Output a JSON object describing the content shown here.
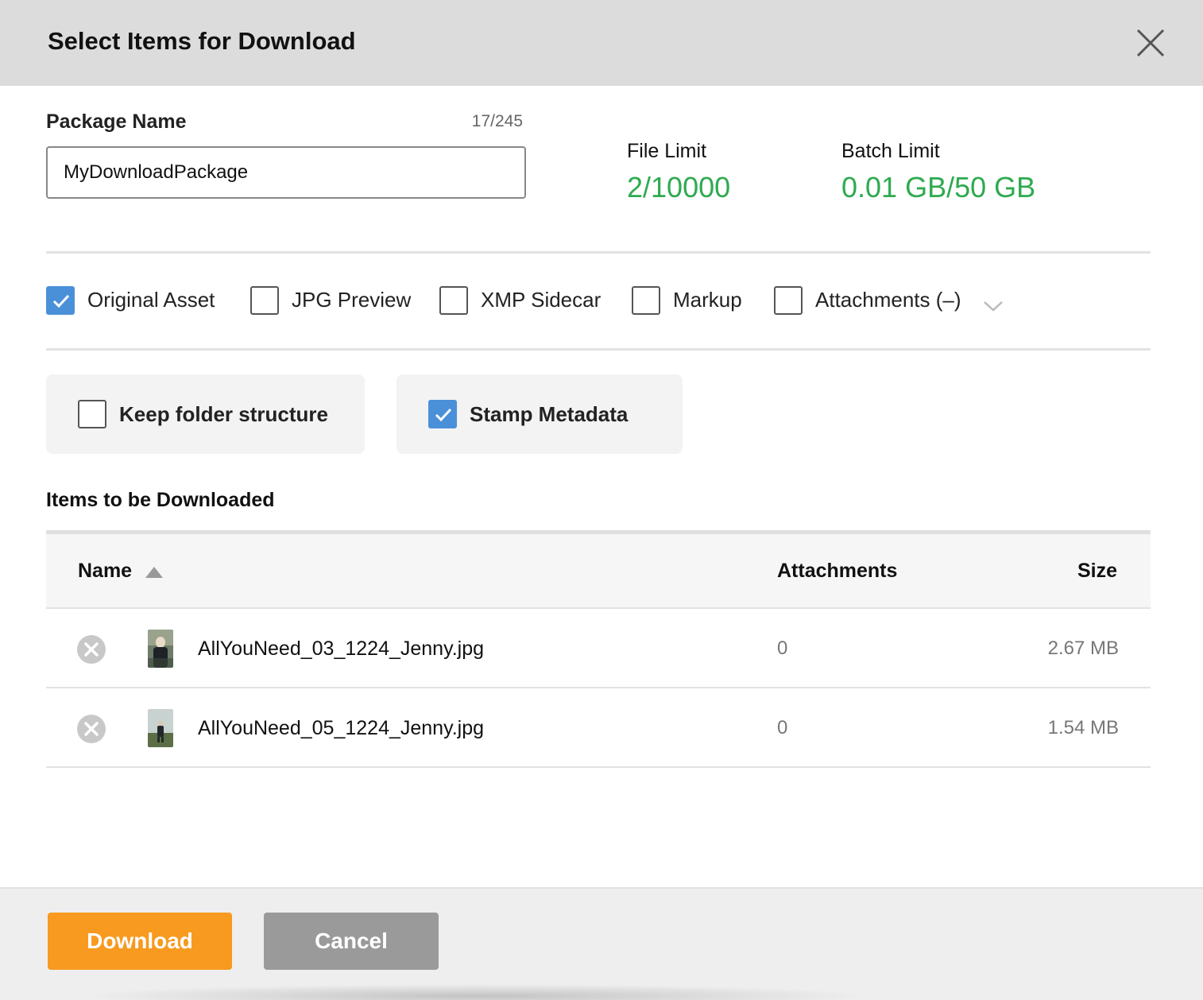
{
  "dialog": {
    "title": "Select Items for Download"
  },
  "package": {
    "label": "Package Name",
    "char_count": "17/245",
    "value": "MyDownloadPackage"
  },
  "limits": {
    "file_label": "File Limit",
    "file_value": "2/10000",
    "batch_label": "Batch Limit",
    "batch_value": "0.01 GB/50 GB",
    "value_color": "#2eaa4f"
  },
  "formats": [
    {
      "label": "Original Asset",
      "checked": true
    },
    {
      "label": "JPG Preview",
      "checked": false
    },
    {
      "label": "XMP Sidecar",
      "checked": false
    },
    {
      "label": "Markup",
      "checked": false
    },
    {
      "label": "Attachments (–)",
      "checked": false
    }
  ],
  "options": [
    {
      "label": "Keep folder structure",
      "checked": false
    },
    {
      "label": "Stamp Metadata",
      "checked": true
    }
  ],
  "items_section": {
    "title": "Items to be Downloaded",
    "columns": {
      "name": "Name",
      "attachments": "Attachments",
      "size": "Size"
    },
    "rows": [
      {
        "name": "AllYouNeed_03_1224_Jenny.jpg",
        "attachments": "0",
        "size": "2.67 MB"
      },
      {
        "name": "AllYouNeed_05_1224_Jenny.jpg",
        "attachments": "0",
        "size": "1.54 MB"
      }
    ]
  },
  "footer": {
    "download_label": "Download",
    "cancel_label": "Cancel"
  },
  "colors": {
    "checkbox_checked": "#4a90d9",
    "download_button": "#f79a1f",
    "cancel_button": "#9a9a9a",
    "header_bg": "#dcdcdc"
  },
  "icons": {
    "close": "close-icon",
    "chevron": "chevron-down-icon",
    "sort": "sort-ascending-icon",
    "remove": "remove-circle-icon",
    "check": "check-icon"
  }
}
